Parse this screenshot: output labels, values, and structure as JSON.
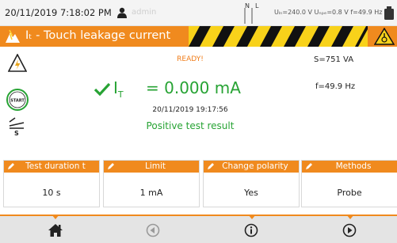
{
  "status": {
    "datetime": "20/11/2019 7:18:02 PM",
    "user": "admin",
    "n_label": "N",
    "l_label": "L",
    "measurements": "Uₗₙ=240.0 V Uₙₚₑ=0.8 V f=49.9 Hz"
  },
  "title": "Iₜ - Touch leakage current",
  "main": {
    "ready_label": "READY!",
    "result_symbol": "I",
    "result_subscript": "T",
    "result_value": "= 0.000 mA",
    "datetime": "20/11/2019 19:17:56",
    "verdict": "Positive test result",
    "s_value": "S=751 VA",
    "f_value": "f=49.9 Hz"
  },
  "parameters": [
    {
      "label": "Test duration t",
      "value": "10 s"
    },
    {
      "label": "Limit",
      "value": "1 mA"
    },
    {
      "label": "Change polarity",
      "value": "Yes"
    },
    {
      "label": "Methods",
      "value": "Probe"
    }
  ],
  "icons": {
    "user": "user-icon",
    "device": "device-icon",
    "title": "leakage-icon",
    "hazard": "hazard-icon",
    "voltage": "voltage-warning-icon",
    "start": "start-icon",
    "probe": "probe-icon",
    "check": "check-icon",
    "home": "home-icon",
    "prev": "prev-icon",
    "info": "info-icon",
    "next": "next-icon"
  },
  "colors": {
    "accent": "#f08a1e",
    "success": "#27a334"
  }
}
